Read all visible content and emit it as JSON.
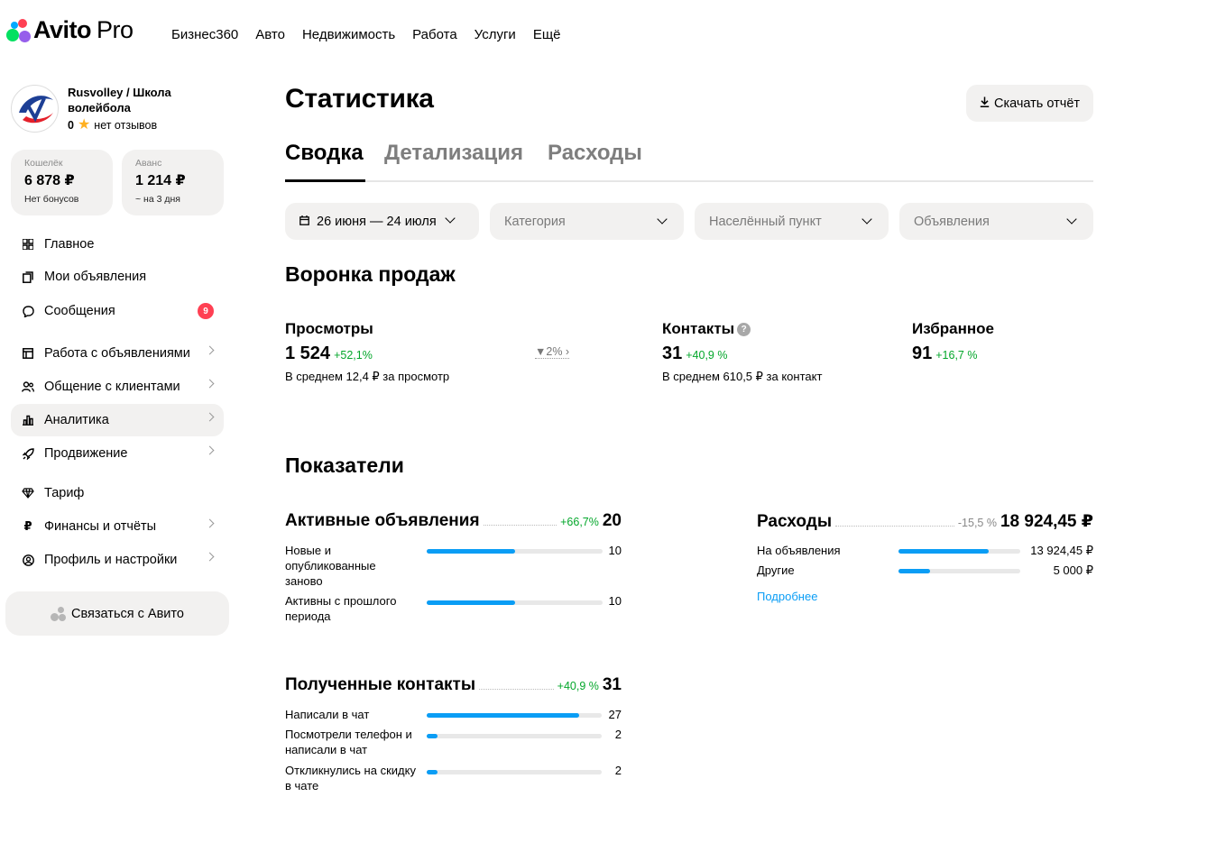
{
  "brand": {
    "name": "Avito",
    "suffix": "Pro",
    "dot_colors": [
      "#04e061",
      "#ff4053",
      "#965eeb",
      "#0af"
    ]
  },
  "topnav": [
    "Бизнес360",
    "Авто",
    "Недвижимость",
    "Работа",
    "Услуги",
    "Ещё"
  ],
  "profile": {
    "name": "Rusvolley / Школа волейбола",
    "rating": "0",
    "reviews": "нет отзывов"
  },
  "wallets": [
    {
      "label": "Кошелёк",
      "amount": "6 878 ₽",
      "sub": "Нет бонусов"
    },
    {
      "label": "Аванс",
      "amount": "1 214 ₽",
      "sub": "~ на 3 дня"
    }
  ],
  "sidebar": {
    "items": [
      {
        "label": "Главное",
        "icon": "grid-icon"
      },
      {
        "label": "Мои объявления",
        "icon": "copy-icon"
      },
      {
        "label": "Сообщения",
        "icon": "chat-icon",
        "badge": "9"
      },
      {
        "label": "Работа с объявлениями",
        "icon": "board-icon"
      },
      {
        "label": "Общение с клиентами",
        "icon": "users-icon"
      },
      {
        "label": "Аналитика",
        "icon": "chart-icon",
        "active": true
      },
      {
        "label": "Продвижение",
        "icon": "rocket-icon"
      },
      {
        "label": "Тариф",
        "icon": "diamond-icon"
      },
      {
        "label": "Финансы и отчёты",
        "icon": "ruble-icon"
      },
      {
        "label": "Профиль и настройки",
        "icon": "profile-icon"
      }
    ],
    "contact_button": "Связаться с Авито"
  },
  "page": {
    "title": "Статистика",
    "download": "Скачать отчёт"
  },
  "tabs": [
    "Сводка",
    "Детализация",
    "Расходы"
  ],
  "filters": {
    "date": "26 июня — 24 июля",
    "category": "Категория",
    "city": "Населённый пункт",
    "ads": "Объявления"
  },
  "funnel": {
    "title": "Воронка продаж",
    "views": {
      "title": "Просмотры",
      "value": "1 524",
      "delta": "+52,1%",
      "sub": "В среднем 12,4 ₽ за просмотр"
    },
    "conversion": "2%",
    "contacts": {
      "title": "Контакты",
      "value": "31",
      "delta": "+40,9 %",
      "sub": "В среднем 610,5 ₽ за контакт"
    },
    "favorites": {
      "title": "Избранное",
      "value": "91",
      "delta": "+16,7 %"
    }
  },
  "indicators": {
    "title": "Показатели",
    "active_ads": {
      "title": "Активные объявления",
      "delta": "+66,7%",
      "value": "20",
      "rows": [
        {
          "label": "Новые и опубликованные заново",
          "value": "10",
          "fill": 0.5
        },
        {
          "label": "Активны с прошлого периода",
          "value": "10",
          "fill": 0.5
        }
      ]
    },
    "expenses": {
      "title": "Расходы",
      "delta": "-15,5 %",
      "value": "18 924,45 ₽",
      "rows": [
        {
          "label": "На объявления",
          "value": "13 924,45 ₽",
          "fill": 0.74
        },
        {
          "label": "Другие",
          "value": "5 000 ₽",
          "fill": 0.26
        }
      ],
      "more": "Подробнее"
    },
    "contacts": {
      "title": "Полученные контакты",
      "delta": "+40,9 %",
      "value": "31",
      "rows": [
        {
          "label": "Написали в чат",
          "value": "27",
          "fill": 0.87
        },
        {
          "label": "Посмотрели телефон и написали в чат",
          "value": "2",
          "fill": 0.06
        },
        {
          "label": "Откликнулись на скидку в чате",
          "value": "2",
          "fill": 0.06
        }
      ]
    }
  }
}
